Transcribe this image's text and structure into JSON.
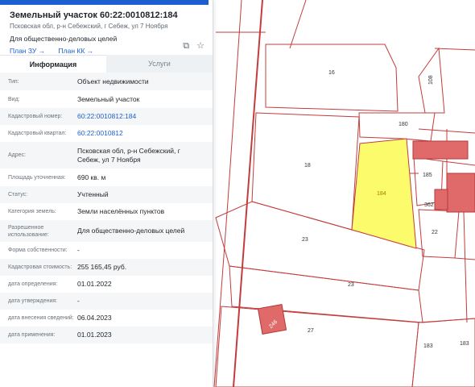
{
  "header": {
    "title": "Земельный участок 60:22:0010812:184",
    "address": "Псковская обл, р-н Себежский, г Себеж, ул 7 Ноября",
    "purpose": "Для общественно-деловых целей",
    "link_plan_zu": "План ЗУ →",
    "link_plan_kk": "План КК →"
  },
  "tabs": {
    "info": "Информация",
    "services": "Услуги"
  },
  "rows": [
    {
      "label": "Тип:",
      "value": "Объект недвижимости"
    },
    {
      "label": "Вид:",
      "value": "Земельный участок"
    },
    {
      "label": "Кадастровый номер:",
      "value": "60:22:0010812:184"
    },
    {
      "label": "Кадастровый квартал:",
      "value": "60:22:0010812"
    },
    {
      "label": "Адрес:",
      "value": "Псковская обл, р-н Себежский, г Себеж, ул 7 Ноября"
    },
    {
      "label": "Площадь уточненная:",
      "value": "690 кв. м"
    },
    {
      "label": "Статус:",
      "value": "Учтенный"
    },
    {
      "label": "Категория земель:",
      "value": "Земли населённых пунктов"
    },
    {
      "label": "Разрешенное использование:",
      "value": "Для общественно-деловых целей"
    },
    {
      "label": "Форма собственности:",
      "value": "-"
    },
    {
      "label": "Кадастровая стоимость:",
      "value": "255 165,45 руб."
    },
    {
      "label": "дата определения:",
      "value": "01.01.2022"
    },
    {
      "label": "дата утверждения:",
      "value": "-"
    },
    {
      "label": "дата внесения сведений:",
      "value": "06.04.2023"
    },
    {
      "label": "дата применения:",
      "value": "01.01.2023"
    }
  ],
  "map": {
    "parcel_numbers": {
      "p16": "16",
      "p18": "18",
      "p180": "180",
      "p184": "184",
      "p185": "185",
      "p23a": "23",
      "p23b": "23",
      "p22": "22",
      "p27": "27",
      "p183a": "183",
      "p183b": "183",
      "p362": "362",
      "p108": "108",
      "p246": "246"
    },
    "selected_fill": "#fbfb6b",
    "building_fill": "#e06a6a",
    "boundary_color": "#c33c3c"
  }
}
